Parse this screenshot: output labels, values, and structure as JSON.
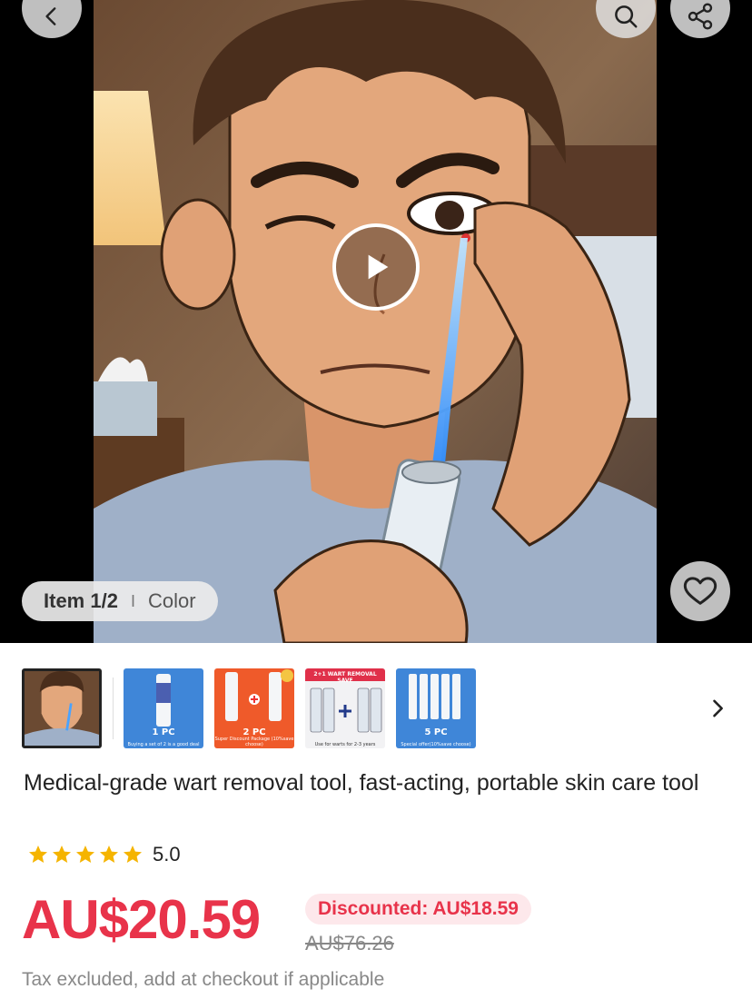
{
  "media": {
    "item_label": "Item 1/2",
    "item_separator": "I",
    "color_label": "Color",
    "icons": [
      "back-icon",
      "search-icon",
      "share-icon",
      "play-icon",
      "heart-icon"
    ]
  },
  "thumbnails": [
    {
      "name": "main-video",
      "selected": true
    },
    {
      "name": "1pc",
      "caption": "1 PC",
      "sub": "Buying a set of 2 is a good deal"
    },
    {
      "name": "2pc",
      "caption": "2 PC",
      "sub": "Super Discount Package (10%save choose)"
    },
    {
      "name": "2plus1",
      "top": "2+1 WART REMOVAL SAVE",
      "sub": "Use for warts for 2-3 years"
    },
    {
      "name": "5pc",
      "caption": "5 PC",
      "sub": "Special offer(10%save choose)"
    }
  ],
  "product": {
    "title": "Medical-grade wart removal tool, fast-acting, portable skin care tool",
    "rating": "5.0",
    "stars": 5,
    "price": "AU$20.59",
    "discount_badge": "Discounted: AU$18.59",
    "original_price": "AU$76.26",
    "tax_note": "Tax excluded, add at checkout if applicable"
  },
  "colors": {
    "accent": "#e8334a",
    "star": "#f5b400",
    "badge_bg": "#fde8eb"
  }
}
